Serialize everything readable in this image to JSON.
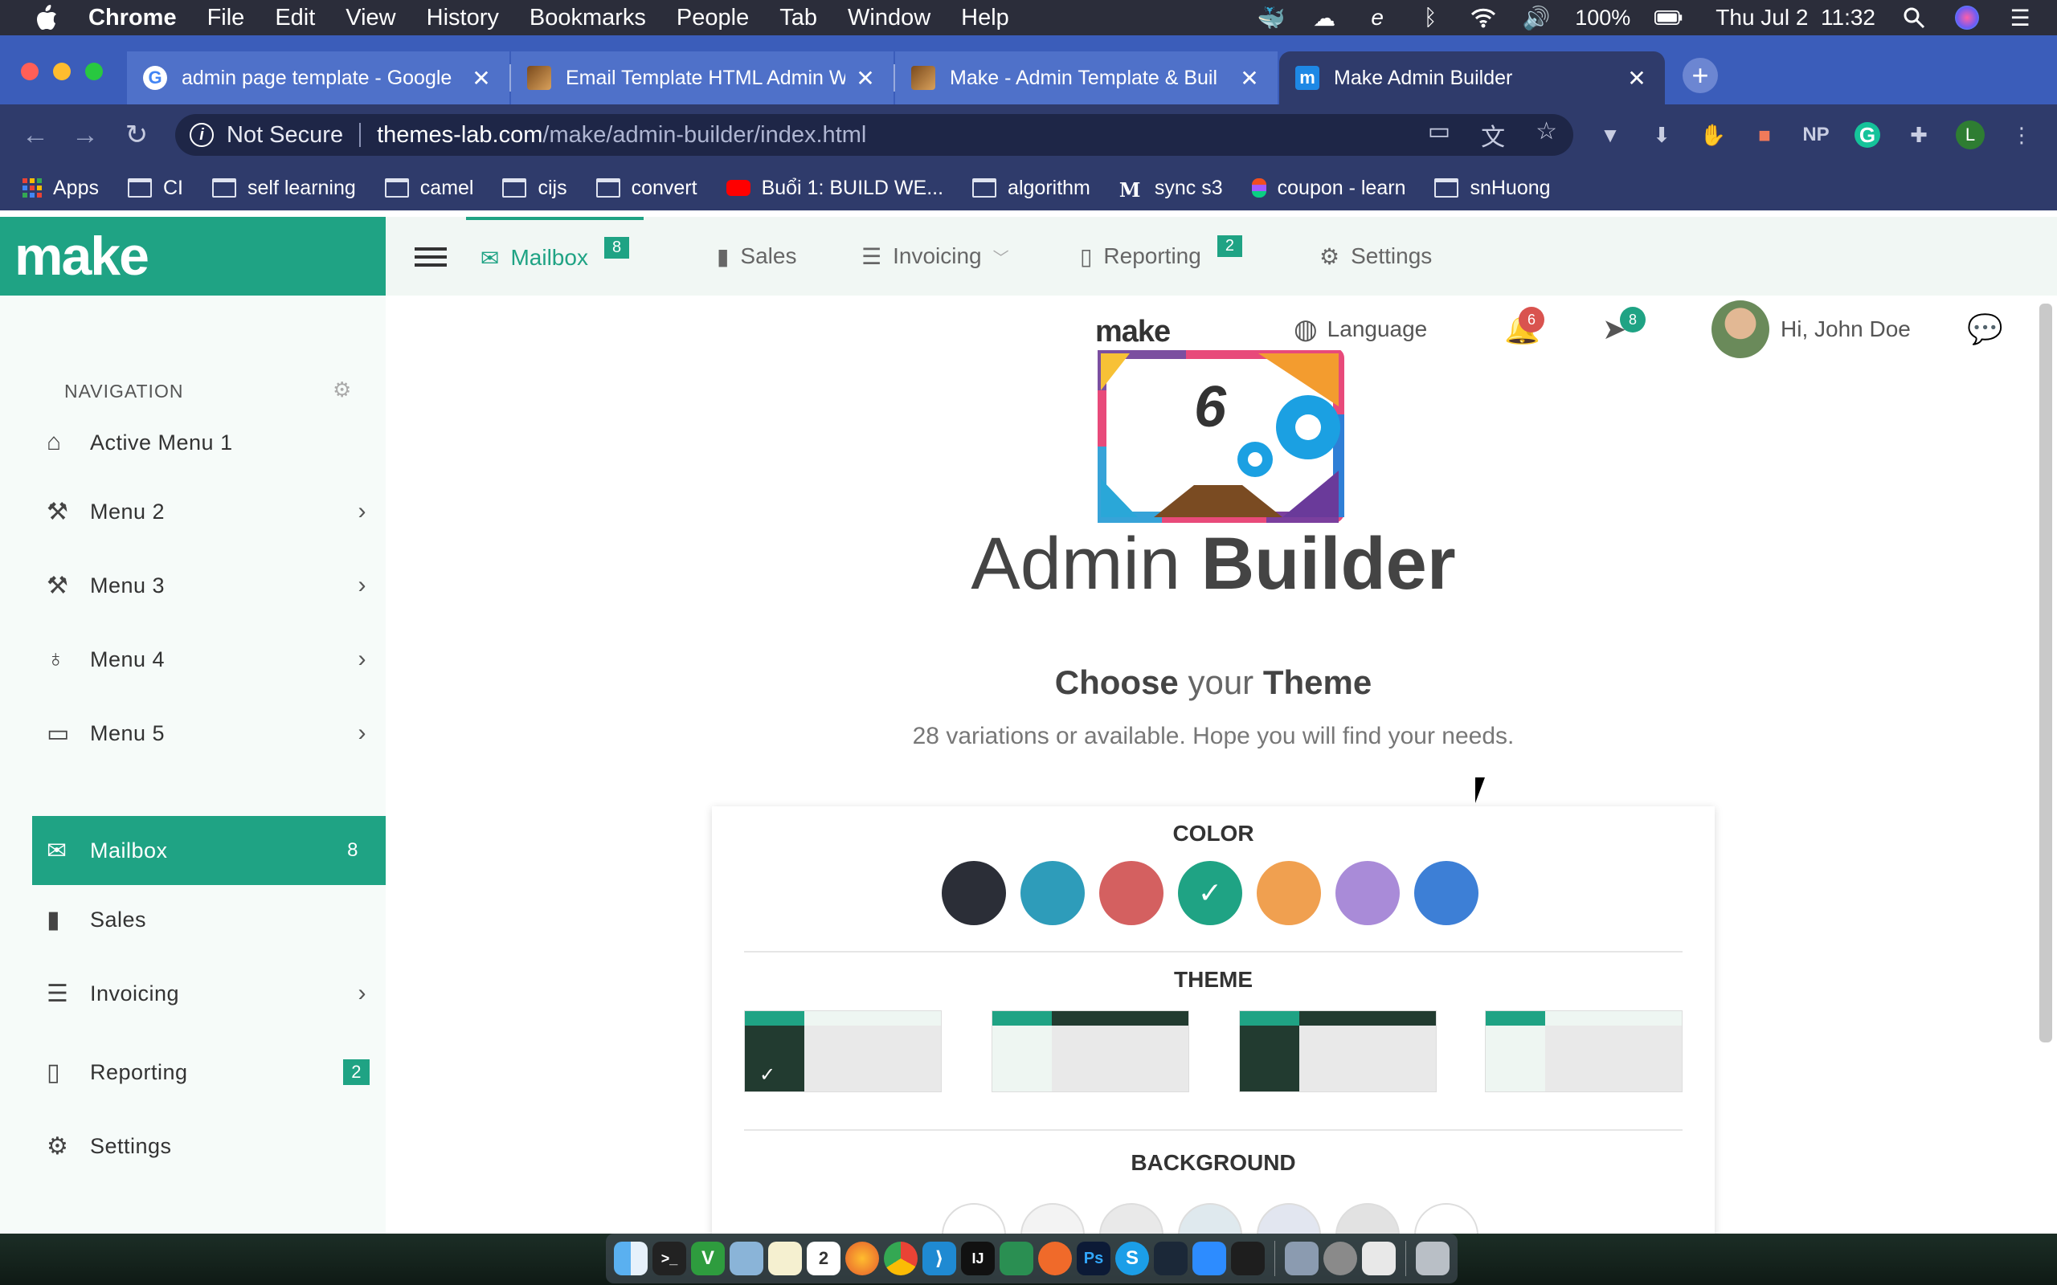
{
  "mac_menubar": {
    "items": [
      "Chrome",
      "File",
      "Edit",
      "View",
      "History",
      "Bookmarks",
      "People",
      "Tab",
      "Window",
      "Help"
    ],
    "battery": "100%",
    "clock": "Thu Jul 2  11:32"
  },
  "tabs": [
    {
      "title": "admin page template - Google",
      "favicon": "google-icon"
    },
    {
      "title": "Email Template HTML Admin W",
      "favicon": "site-icon"
    },
    {
      "title": "Make - Admin Template & Buil",
      "favicon": "site-icon"
    },
    {
      "title": "Make Admin Builder",
      "favicon": "make-m-icon",
      "active": true
    }
  ],
  "omnibox": {
    "security": "Not Secure",
    "host": "themes-lab.com",
    "path": "/make/admin-builder/index.html"
  },
  "bookmarks": [
    {
      "label": "Apps",
      "icon": "apps-grid-icon"
    },
    {
      "label": "CI",
      "icon": "folder-icon"
    },
    {
      "label": "self learning",
      "icon": "folder-icon"
    },
    {
      "label": "camel",
      "icon": "folder-icon"
    },
    {
      "label": "cijs",
      "icon": "folder-icon"
    },
    {
      "label": "convert",
      "icon": "folder-icon"
    },
    {
      "label": "Buổi 1: BUILD WE...",
      "icon": "youtube-icon"
    },
    {
      "label": "algorithm",
      "icon": "folder-icon"
    },
    {
      "label": "sync s3",
      "icon": "medium-icon"
    },
    {
      "label": "coupon - learn",
      "icon": "figma-icon"
    },
    {
      "label": "snHuong",
      "icon": "folder-icon"
    }
  ],
  "brand": "make",
  "topnav": {
    "items": [
      {
        "label": "Mailbox",
        "badge": "8",
        "icon": "envelope-icon"
      },
      {
        "label": "Sales",
        "icon": "bar-chart-icon"
      },
      {
        "label": "Invoicing",
        "icon": "list-icon"
      },
      {
        "label": "Reporting",
        "badge": "2",
        "icon": "notebook-icon"
      },
      {
        "label": "Settings",
        "icon": "gear-icon"
      }
    ]
  },
  "header_tools": {
    "logo_text": "make",
    "language": "Language",
    "notifications_count": "6",
    "messages_count": "8",
    "greeting": "Hi, John Doe"
  },
  "sidebar": {
    "title": "NAVIGATION",
    "items": [
      {
        "label": "Active Menu 1",
        "icon": "home-icon"
      },
      {
        "label": "Menu 2",
        "icon": "wrench-icon"
      },
      {
        "label": "Menu 3",
        "icon": "wrench-icon"
      },
      {
        "label": "Menu 4",
        "icon": "lightbulb-icon"
      },
      {
        "label": "Menu 5",
        "icon": "monitor-icon"
      },
      {
        "label": "Mailbox",
        "icon": "envelope-icon",
        "count": "8"
      },
      {
        "label": "Sales",
        "icon": "bar-chart-icon"
      },
      {
        "label": "Invoicing",
        "icon": "list-icon"
      },
      {
        "label": "Reporting",
        "icon": "notebook-icon",
        "badge": "2"
      },
      {
        "label": "Settings",
        "icon": "gear-icon"
      }
    ]
  },
  "hero": {
    "logo_number": "6",
    "title_light": "Admin",
    "title_bold": "Builder",
    "choose_bold1": "Choose",
    "choose_light": "your",
    "choose_bold2": "Theme",
    "subtitle": "28 variations or available. Hope you will find your needs."
  },
  "options": {
    "color_label": "COLOR",
    "theme_label": "THEME",
    "background_label": "BACKGROUND",
    "colors": [
      "#2b2e37",
      "#2e9cba",
      "#d46060",
      "#1fa384",
      "#f0a050",
      "#a98bd8",
      "#3d7fd6"
    ],
    "selected_color": 4,
    "backgrounds": [
      "#ffffff",
      "#f3f3f3",
      "#e9e9e9",
      "#dfe9ee",
      "#e2e6f0",
      "#e2e2e2",
      "#ffffff"
    ]
  },
  "accent_color": "#1fa384"
}
